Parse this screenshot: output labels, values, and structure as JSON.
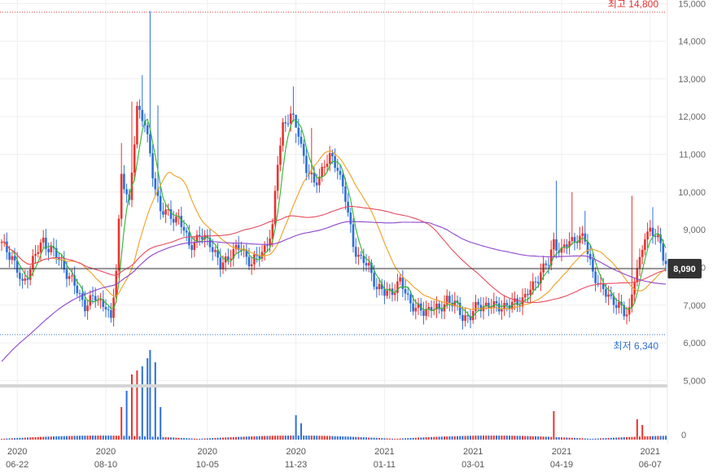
{
  "chart_data": {
    "type": "candlestick",
    "price_axis": {
      "ticks": [
        "15,000",
        "14,000",
        "13,000",
        "12,000",
        "11,000",
        "10,000",
        "9,000",
        "8,000",
        "7,000",
        "6,000",
        "5,000"
      ],
      "tick_values": [
        15000,
        14000,
        13000,
        12000,
        11000,
        10000,
        9000,
        8000,
        7000,
        6000,
        5000
      ],
      "range": [
        4900,
        15050
      ]
    },
    "volume_axis": {
      "ticks": [
        "0"
      ]
    },
    "high": {
      "label": "최고 14,800",
      "value": 14800
    },
    "low": {
      "label": "최저 6,340",
      "value": 6340
    },
    "current": {
      "label": "8,090",
      "value": 8090
    },
    "x_ticks": [
      {
        "year": "2020",
        "date": "06-22",
        "index": 6
      },
      {
        "year": "2020",
        "date": "08-10",
        "index": 40
      },
      {
        "year": "2020",
        "date": "10-05",
        "index": 79
      },
      {
        "year": "2020",
        "date": "11-23",
        "index": 113
      },
      {
        "year": "2021",
        "date": "01-11",
        "index": 147
      },
      {
        "year": "2021",
        "date": "03-01",
        "index": 181
      },
      {
        "year": "2021",
        "date": "04-19",
        "index": 215
      },
      {
        "year": "2021",
        "date": "06-07",
        "index": 249
      }
    ],
    "close_anchors": [
      [
        0,
        8600
      ],
      [
        4,
        8300
      ],
      [
        8,
        7500
      ],
      [
        12,
        8200
      ],
      [
        16,
        8700
      ],
      [
        20,
        8400
      ],
      [
        24,
        8000
      ],
      [
        28,
        7500
      ],
      [
        32,
        7000
      ],
      [
        36,
        7200
      ],
      [
        40,
        7000
      ],
      [
        42,
        6500
      ],
      [
        44,
        8000
      ],
      [
        46,
        10500
      ],
      [
        49,
        9600
      ],
      [
        52,
        12300
      ],
      [
        55,
        11800
      ],
      [
        58,
        10500
      ],
      [
        61,
        9500
      ],
      [
        64,
        9400
      ],
      [
        68,
        9300
      ],
      [
        72,
        8600
      ],
      [
        76,
        8800
      ],
      [
        80,
        8700
      ],
      [
        84,
        8000
      ],
      [
        88,
        8400
      ],
      [
        92,
        8500
      ],
      [
        96,
        8100
      ],
      [
        100,
        8400
      ],
      [
        104,
        9000
      ],
      [
        106,
        10800
      ],
      [
        108,
        11800
      ],
      [
        111,
        12000
      ],
      [
        114,
        11600
      ],
      [
        117,
        10600
      ],
      [
        120,
        10200
      ],
      [
        123,
        10600
      ],
      [
        126,
        10900
      ],
      [
        129,
        10700
      ],
      [
        132,
        9800
      ],
      [
        135,
        8600
      ],
      [
        138,
        8200
      ],
      [
        141,
        8000
      ],
      [
        144,
        7500
      ],
      [
        147,
        7300
      ],
      [
        150,
        7400
      ],
      [
        153,
        7600
      ],
      [
        156,
        7200
      ],
      [
        159,
        6900
      ],
      [
        162,
        6800
      ],
      [
        165,
        7000
      ],
      [
        168,
        6800
      ],
      [
        171,
        7200
      ],
      [
        174,
        7000
      ],
      [
        177,
        6700
      ],
      [
        180,
        6700
      ],
      [
        183,
        7000
      ],
      [
        186,
        7000
      ],
      [
        189,
        6950
      ],
      [
        192,
        7000
      ],
      [
        195,
        6950
      ],
      [
        198,
        7100
      ],
      [
        201,
        7200
      ],
      [
        204,
        7500
      ],
      [
        207,
        7900
      ],
      [
        210,
        8100
      ],
      [
        212,
        8700
      ],
      [
        215,
        8400
      ],
      [
        218,
        8700
      ],
      [
        221,
        8800
      ],
      [
        224,
        8700
      ],
      [
        227,
        7900
      ],
      [
        230,
        7400
      ],
      [
        233,
        7300
      ],
      [
        236,
        7000
      ],
      [
        239,
        6800
      ],
      [
        241,
        6900
      ],
      [
        243,
        7700
      ],
      [
        245,
        8100
      ],
      [
        247,
        8900
      ],
      [
        249,
        9000
      ],
      [
        251,
        8800
      ],
      [
        253,
        8600
      ],
      [
        255,
        8090
      ]
    ],
    "spikes": [
      [
        46,
        11300
      ],
      [
        50,
        12400
      ],
      [
        54,
        13100
      ],
      [
        57,
        14800
      ],
      [
        60,
        12300
      ],
      [
        112,
        12800
      ],
      [
        113,
        11300
      ],
      [
        119,
        11700
      ],
      [
        213,
        10300
      ],
      [
        219,
        10000
      ],
      [
        224,
        9500
      ],
      [
        242,
        9900
      ],
      [
        250,
        9600
      ]
    ],
    "volume_spikes": [
      [
        46,
        40
      ],
      [
        48,
        60
      ],
      [
        50,
        80
      ],
      [
        52,
        85
      ],
      [
        54,
        90
      ],
      [
        56,
        100
      ],
      [
        57,
        110
      ],
      [
        59,
        95
      ],
      [
        61,
        40
      ],
      [
        113,
        30
      ],
      [
        115,
        20
      ],
      [
        212,
        35
      ],
      [
        244,
        25
      ],
      [
        246,
        18
      ]
    ],
    "moving_averages": [
      {
        "period": 5,
        "color": "#2db52d"
      },
      {
        "period": 20,
        "color": "#f0a020"
      },
      {
        "period": 60,
        "color": "#e84a5f"
      },
      {
        "period": 120,
        "color": "#8e44ce"
      }
    ],
    "grid": true,
    "colors": {
      "up": "#e8342f",
      "down": "#2d6fd9",
      "grid": "#efefef"
    }
  }
}
